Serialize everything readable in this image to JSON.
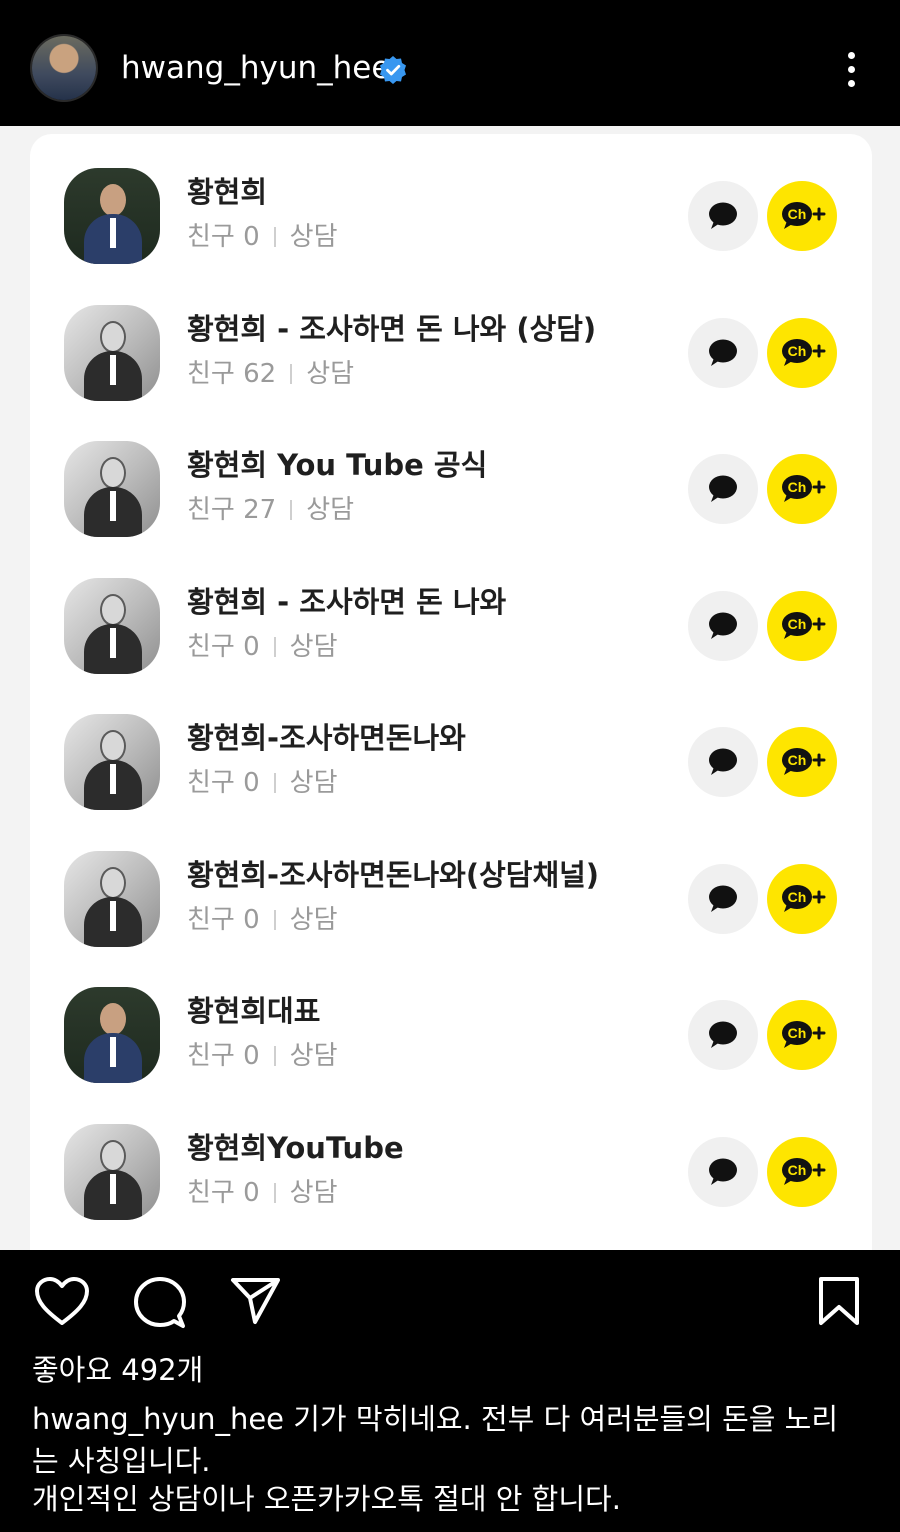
{
  "header": {
    "username": "hwang_hyun_hee",
    "verified_icon": "verified-badge-icon",
    "more_icon": "more-vertical-icon"
  },
  "channels": [
    {
      "name": "황현희",
      "friends": "친구 0",
      "category": "상담",
      "avatar": "color"
    },
    {
      "name": "황현희 - 조사하면 돈 나와 (상담)",
      "friends": "친구 62",
      "category": "상담",
      "avatar": "gray"
    },
    {
      "name": "황현희 You Tube 공식",
      "friends": "친구 27",
      "category": "상담",
      "avatar": "gray"
    },
    {
      "name": "황현희 - 조사하면 돈 나와",
      "friends": "친구 0",
      "category": "상담",
      "avatar": "gray"
    },
    {
      "name": "황현희-조사하면돈나와",
      "friends": "친구 0",
      "category": "상담",
      "avatar": "gray"
    },
    {
      "name": "황현희-조사하면돈나와(상담채널)",
      "friends": "친구 0",
      "category": "상담",
      "avatar": "gray"
    },
    {
      "name": "황현희대표",
      "friends": "친구 0",
      "category": "상담",
      "avatar": "color"
    },
    {
      "name": "황현희YouTube",
      "friends": "친구 0",
      "category": "상담",
      "avatar": "gray"
    }
  ],
  "channel_buttons": {
    "chat_icon": "chat-bubble-icon",
    "add_channel_label": "Ch+",
    "add_channel_color": "#fee500"
  },
  "actions": {
    "like_icon": "heart-icon",
    "comment_icon": "comment-icon",
    "share_icon": "send-icon",
    "save_icon": "bookmark-icon"
  },
  "post": {
    "likes": "좋아요 492개",
    "caption_user": "hwang_hyun_hee",
    "caption_text": "기가 막히네요. 전부 다 여러분들의 돈을 노리는 사칭입니다.",
    "caption_text2": "개인적인 상담이나 오픈카카오톡 절대 안 합니다."
  },
  "colors": {
    "background": "#000000",
    "card": "#ffffff",
    "kakao_yellow": "#fee500",
    "verified_blue": "#3897f0"
  }
}
